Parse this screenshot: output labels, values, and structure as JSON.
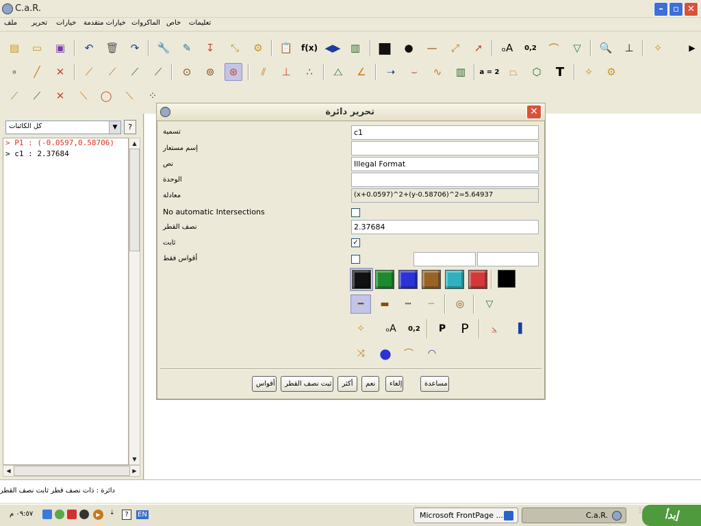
{
  "window": {
    "title": "C.a.R."
  },
  "menu": [
    "ملف",
    "تحرير",
    "خيارات",
    "خيارات متقدمة",
    "الماكروات",
    "خاص",
    "تعليمات"
  ],
  "toolbar": {
    "row1_text_tools": [
      "f(x)",
      "0,2"
    ],
    "row2_text_tools": [
      "a = 2",
      "T"
    ]
  },
  "left_panel": {
    "filter_value": "كل الكائنات",
    "help_button": "?",
    "objects": [
      {
        "text": "> P1 : (-0.0597,0.58706)",
        "color": "#e03020"
      },
      {
        "text": "> c1 : 2.37684",
        "color": "#000000"
      }
    ]
  },
  "dialog": {
    "title": "تحرير دائرة",
    "close_label": "✕",
    "labels": {
      "name": "تسمية",
      "alias": "إسم مستعار",
      "text": "نص",
      "unit": "الوحدة",
      "equation": "معادلة",
      "no_intersections": "No automatic Intersections",
      "radius": "نصف القطر",
      "fixed": "ثابت",
      "arcs_only": "أقواس فقط"
    },
    "values": {
      "name": "c1",
      "alias": "",
      "text": "Illegal Format",
      "unit": "",
      "equation": "(x+0.0597)^2+(y-0.58706)^2=5.64937",
      "radius": "2.37684",
      "no_intersections": false,
      "fixed": true,
      "arcs_only": false
    },
    "colors": [
      "#111111",
      "#1e8a2e",
      "#2b33d6",
      "#9a6326",
      "#2fb2bd",
      "#d43838"
    ],
    "color_black_extra": "#000000",
    "buttons": {
      "arcs": "أقواس",
      "fix_radius": "ثبت نصف القطر",
      "more": "أكثر",
      "ok": "نعم",
      "cancel": "إلغاء",
      "help": "مساعدة"
    },
    "text_options": [
      "P",
      "P",
      "0,2"
    ]
  },
  "status": {
    "text": "دائرة : ذات نصف قطر ثابت نصف القطر ؟"
  },
  "taskbar": {
    "start": "إبدأ",
    "tasks": [
      "Microsoft FrontPage ...",
      "C.a.R."
    ],
    "clock": "٠٩:٥٧ م",
    "lang": "EN"
  }
}
